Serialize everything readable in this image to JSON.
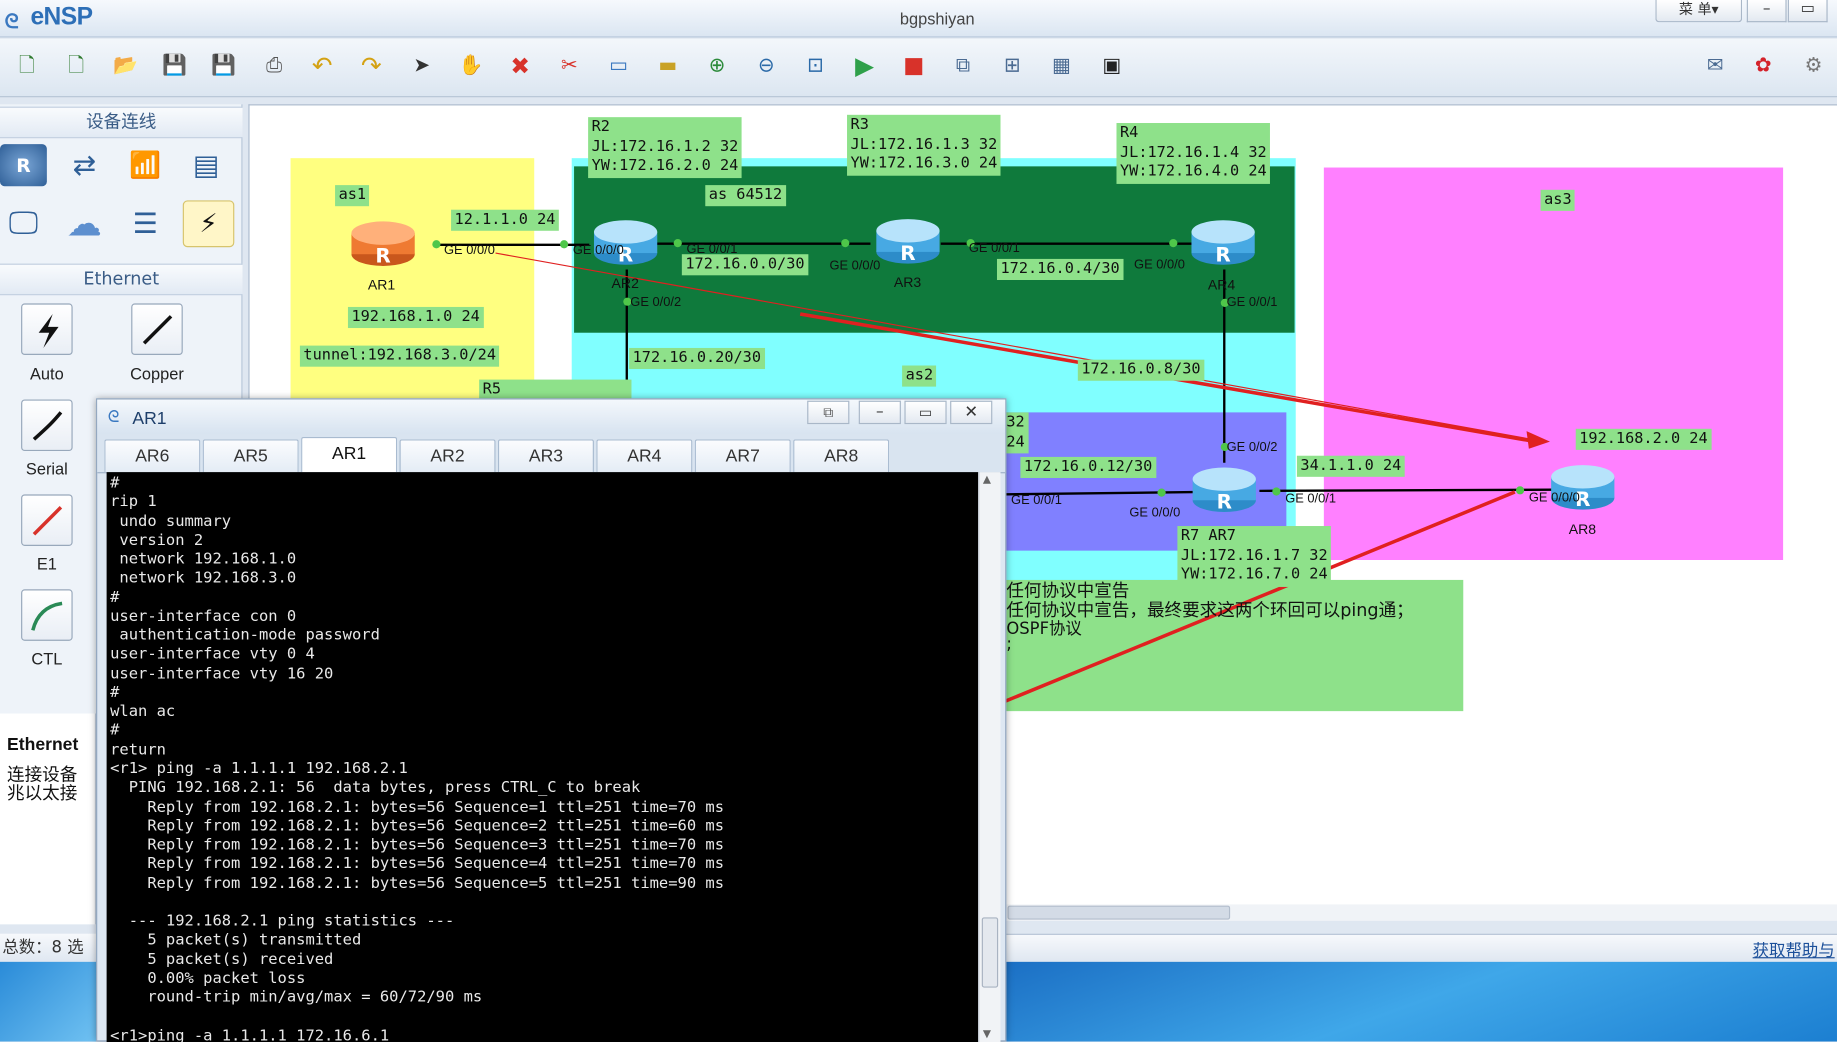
{
  "app": {
    "logo": "eNSP",
    "title": "bgpshiyan",
    "menu_label": "菜 单▾",
    "min_label": "–",
    "max_label": "▭"
  },
  "toolbar": {
    "icons": [
      "new-topology-icon",
      "new-exam-icon",
      "open-icon",
      "save-icon",
      "save-as-icon",
      "print-icon",
      "undo-icon",
      "redo-icon",
      "select-icon",
      "pan-hand-icon",
      "delete-icon",
      "delete-link-icon",
      "text-icon",
      "rectangle-icon",
      "zoom-in-icon",
      "zoom-out-icon",
      "fit-view-icon",
      "start-device-icon",
      "stop-device-icon",
      "capture-icon",
      "topology-icon",
      "grid-icon",
      "snapshot-icon"
    ],
    "right_icons": [
      "message-icon",
      "huawei-icon",
      "settings-icon"
    ]
  },
  "palette": {
    "device_header": "设备连线",
    "ethernet_header": "Ethernet",
    "cables": [
      {
        "label": "Auto"
      },
      {
        "label": "Copper"
      },
      {
        "label": "Serial"
      },
      {
        "label": "E1"
      },
      {
        "label": "CTL"
      }
    ],
    "info_title": "Ethernet",
    "info_text_1": "连接设备",
    "info_text_2": "兆以太接",
    "status": "总数：8 选"
  },
  "canvas": {
    "as_labels": {
      "as1": "as1",
      "as2": "as2",
      "as3": "as3",
      "as64512": "as 64512"
    },
    "r2_info": [
      "R2",
      "JL:172.16.1.2 32",
      "YW:172.16.2.0 24"
    ],
    "r3_info": [
      "R3",
      "JL:172.16.1.3 32",
      "YW:172.16.3.0 24"
    ],
    "r4_info": [
      "R4",
      "JL:172.16.1.4 32",
      "YW:172.16.4.0 24"
    ],
    "r7_info": [
      "R7 AR7",
      "JL:172.16.1.7 32",
      "YW:172.16.7.0 24"
    ],
    "r5_label": "R5",
    "r6_partial": [
      "32",
      "24"
    ],
    "nets": {
      "n1": "12.1.1.0 24",
      "n2": "192.168.1.0 24",
      "n3": "tunnel:192.168.3.0/24",
      "n4": "172.16.0.0/30",
      "n5": "172.16.0.4/30",
      "n6": "172.16.0.20/30",
      "n7": "172.16.0.8/30",
      "n8": "172.16.0.12/30",
      "n9": "34.1.1.0 24",
      "n10": "192.168.2.0 24"
    },
    "routers": {
      "ar1": "AR1",
      "ar2": "AR2",
      "ar3": "AR3",
      "ar4": "AR4",
      "ar7": "AR7",
      "ar8": "AR8"
    },
    "ifaces": {
      "ar1_g000": "GE 0/0/0",
      "ar2_g000": "GE 0/0/0",
      "ar2_g001": "GE 0/0/1",
      "ar2_g002": "GE 0/0/2",
      "ar3_g000": "GE 0/0/0",
      "ar3_g001": "GE 0/0/1",
      "ar4_g000": "GE 0/0/0",
      "ar4_g001": "GE 0/0/1",
      "ar7_g002": "GE 0/0/2",
      "ar7_g001a": "GE 0/0/1",
      "ar7_g000": "GE 0/0/0",
      "ar7_g001b": "GE 0/0/1",
      "ar8_g000": "GE 0/0/0"
    },
    "notes": {
      "l1": "任何协议中宣告",
      "l2": "任何协议中宣告，最终要求这两个环回可以ping通；",
      "l3": "OSPF协议",
      "l4": ";"
    },
    "help": "获取帮助与"
  },
  "terminal": {
    "title": "AR1",
    "tabs": [
      "AR6",
      "AR5",
      "AR1",
      "AR2",
      "AR3",
      "AR4",
      "AR7",
      "AR8"
    ],
    "active_tab": "AR1",
    "lines": [
      "#",
      "rip 1",
      " undo summary",
      " version 2",
      " network 192.168.1.0",
      " network 192.168.3.0",
      "#",
      "user-interface con 0",
      " authentication-mode password",
      "user-interface vty 0 4",
      "user-interface vty 16 20",
      "#",
      "wlan ac",
      "#",
      "return",
      "<r1> ping -a 1.1.1.1 192.168.2.1",
      "  PING 192.168.2.1: 56  data bytes, press CTRL_C to break",
      "    Reply from 192.168.2.1: bytes=56 Sequence=1 ttl=251 time=70 ms",
      "    Reply from 192.168.2.1: bytes=56 Sequence=2 ttl=251 time=60 ms",
      "    Reply from 192.168.2.1: bytes=56 Sequence=3 ttl=251 time=70 ms",
      "    Reply from 192.168.2.1: bytes=56 Sequence=4 ttl=251 time=70 ms",
      "    Reply from 192.168.2.1: bytes=56 Sequence=5 ttl=251 time=90 ms",
      "",
      "  --- 192.168.2.1 ping statistics ---",
      "    5 packet(s) transmitted",
      "    5 packet(s) received",
      "    0.00% packet loss",
      "    round-trip min/avg/max = 60/72/90 ms",
      "",
      "<r1>ping -a 1.1.1.1 172.16.6.1"
    ]
  }
}
